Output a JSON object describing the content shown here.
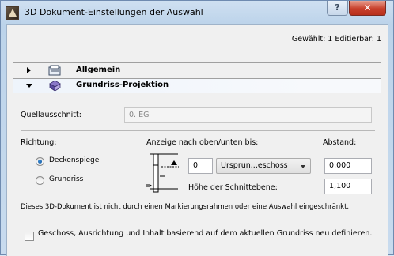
{
  "window": {
    "title": "3D Dokument-Einstellungen der Auswahl",
    "help_glyph": "?",
    "close_glyph": "✕"
  },
  "selection_count": "Gewählt: 1 Editierbar: 1",
  "sections": [
    {
      "label": "Allgemein",
      "expanded": false,
      "icon": "general-settings-icon"
    },
    {
      "label": "Grundriss-Projektion",
      "expanded": true,
      "icon": "floorplan-projection-icon"
    }
  ],
  "source": {
    "label": "Quellausschnitt:",
    "value": "0. EG",
    "disabled": true
  },
  "direction": {
    "label": "Richtung:",
    "options": [
      {
        "label": "Deckenspiegel",
        "checked": true
      },
      {
        "label": "Grundriss",
        "checked": false
      }
    ]
  },
  "display": {
    "label": "Anzeige nach oben/unten bis:",
    "story_value": "0",
    "story_combo": "Ursprun...eschoss",
    "distance_label": "Abstand:",
    "distance_value": "0,000",
    "cut_plane_label": "Höhe der Schnittebene:",
    "cut_plane_value": "1,100"
  },
  "info_text": "Dieses 3D-Dokument ist nicht durch einen Markierungsrahmen oder eine Auswahl eingeschränkt.",
  "redefine": {
    "label": "Geschoss, Ausrichtung und Inhalt basierend auf dem aktuellen Grundriss neu definieren.",
    "checked": false
  },
  "colors": {
    "accent": "#0e4f97",
    "close": "#c8402c",
    "title_bar": "#bcd3ea"
  }
}
